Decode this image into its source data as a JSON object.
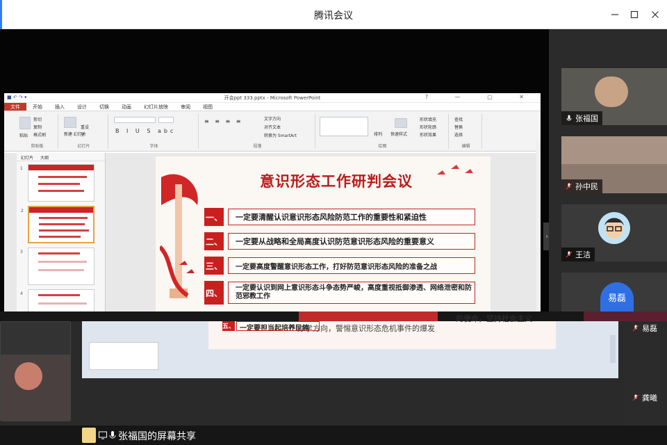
{
  "window": {
    "title": "腾讯会议"
  },
  "ppt": {
    "title": "开会ppt  333.pptx - Microsoft PowerPoint",
    "tabs": [
      "文件",
      "开始",
      "插入",
      "设计",
      "切换",
      "动画",
      "幻灯片放映",
      "审阅",
      "视图"
    ],
    "ribbon": {
      "clipboard": "剪贴板",
      "slides": "幻灯片",
      "font": "字体",
      "paragraph": "段落",
      "drawing": "绘图",
      "editing": "编辑",
      "paste": "粘贴",
      "new_slide": "新建\n幻灯片",
      "reset": "重设",
      "section": "节",
      "cut": "剪切",
      "copy": "复制",
      "format_painter": "格式刷",
      "text_direction": "文字方向",
      "align_text": "对齐文本",
      "smartart": "转换为 SmartArt",
      "arrange": "排列",
      "quick_styles": "快速样式",
      "shape_fill": "形状填充",
      "shape_outline": "形状轮廓",
      "shape_effects": "形状效果",
      "find": "查找",
      "replace": "替换",
      "select": "选择"
    },
    "pane_tabs": [
      "幻灯片",
      "大纲"
    ],
    "slide_numbers": [
      "1",
      "2",
      "3",
      "4"
    ]
  },
  "slide": {
    "title": "意识形态工作研判会议",
    "items": [
      {
        "num": "一、",
        "text": "一定要清醒认识意识形态风险防范工作的重要性和紧迫性"
      },
      {
        "num": "二、",
        "text": "一定要从战略和全局高度认识防范意识形态风险的重要意义"
      },
      {
        "num": "三、",
        "text": "一定要高度警醒意识形态工作，打好防范意识形态风险的准备之战"
      },
      {
        "num": "四、",
        "text": "一定要认识到网上意识形态斗争态势严峻，高度重视抵御渗透、网络泄密和防范邪教工作"
      },
      {
        "num": "五、",
        "text": "一定要担当起培养民族"
      }
    ],
    "fragment_right": "的使命，坚持社会主义",
    "fragment_lower": "办学方向，警惕意识形态危机事件的爆发"
  },
  "participants": [
    {
      "name": "张福国",
      "avatar": "person-photo"
    },
    {
      "name": "孙中民",
      "avatar": "room-photo"
    },
    {
      "name": "王洁",
      "avatar": "cartoon-avatar"
    },
    {
      "name": "易磊",
      "avatar": "initials-badge"
    }
  ],
  "lower_right_names": [
    "易磊",
    "龚曦"
  ],
  "status": {
    "share_text": "张福国的屏幕共享"
  },
  "colors": {
    "accent": "#2f7cf6",
    "slide_red": "#c9201f"
  }
}
